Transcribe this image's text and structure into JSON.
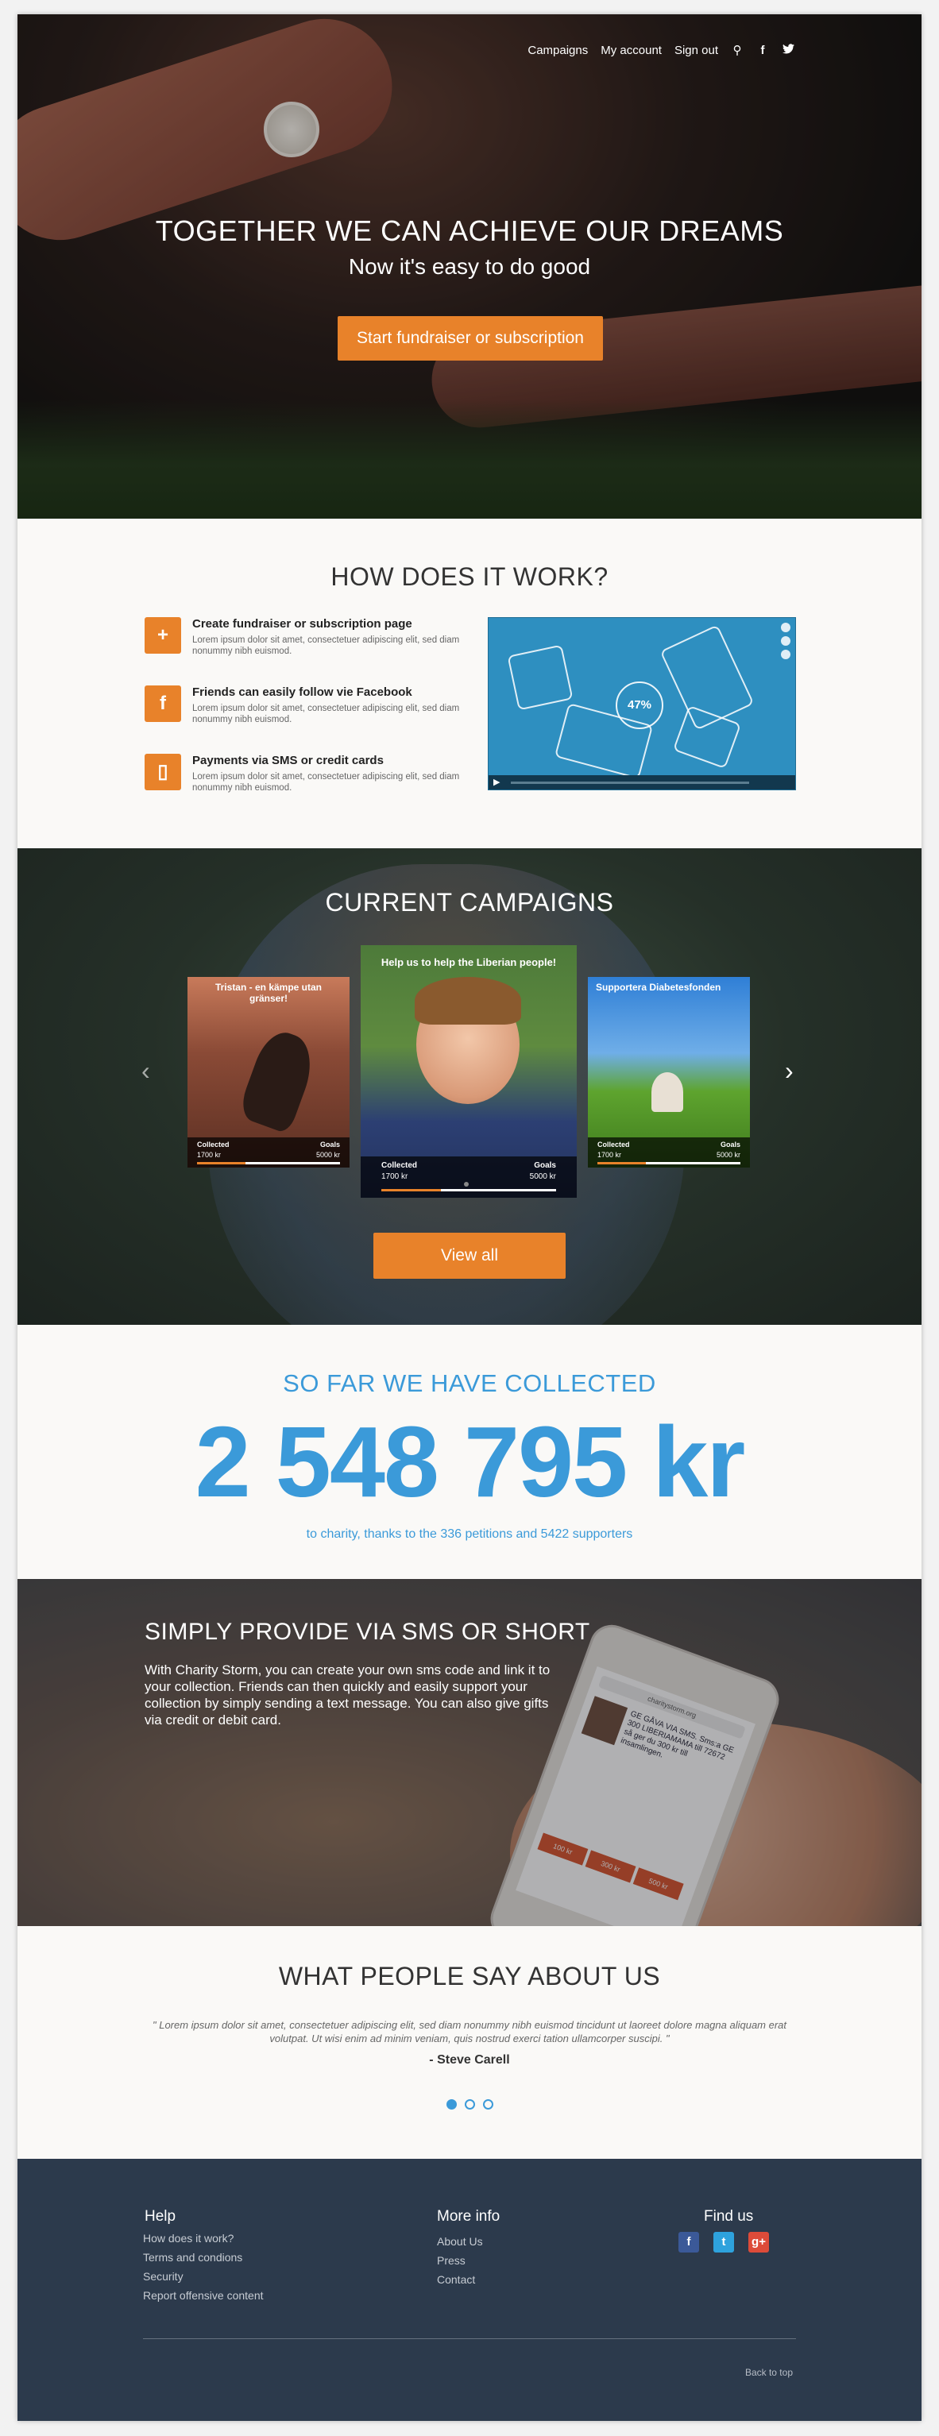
{
  "nav": {
    "campaigns": "Campaigns",
    "my_account": "My account",
    "sign_out": "Sign out",
    "search_icon": "⚲",
    "facebook_icon": "f",
    "twitter_icon": "🐦"
  },
  "hero": {
    "headline": "TOGETHER WE CAN ACHIEVE OUR DREAMS",
    "subheadline": "Now it's easy to do good",
    "cta_label": "Start fundraiser or subscription"
  },
  "how": {
    "title": "HOW DOES IT WORK?",
    "steps": [
      {
        "icon": "+",
        "title": "Create fundraiser or subscription page",
        "text": "Lorem ipsum dolor sit amet, consectetuer adipiscing elit, sed diam nonummy nibh euismod."
      },
      {
        "icon": "f",
        "title": "Friends can easily follow vie Facebook",
        "text": "Lorem ipsum dolor sit amet, consectetuer adipiscing elit, sed diam nonummy nibh euismod."
      },
      {
        "icon": "▯",
        "title": "Payments via SMS or credit cards",
        "text": "Lorem ipsum dolor sit amet, consectetuer adipiscing elit, sed diam nonummy nibh euismod."
      }
    ],
    "video_badge": "47%",
    "play_icon": "▶"
  },
  "campaigns": {
    "title": "CURRENT CAMPAIGNS",
    "prev_icon": "‹",
    "next_icon": "›",
    "view_all_label": "View all",
    "cards": [
      {
        "title": "Tristan - en kämpe utan gränser!",
        "collected_label": "Collected",
        "collected": "1700 kr",
        "goal_label": "Goals",
        "goal": "5000 kr",
        "progress": 0.34
      },
      {
        "title": "Help us to help the Liberian people!",
        "collected_label": "Collected",
        "collected": "1700 kr",
        "goal_label": "Goals",
        "goal": "5000 kr",
        "progress": 0.34
      },
      {
        "title": "Supportera Diabetesfonden",
        "collected_label": "Collected",
        "collected": "1700 kr",
        "goal_label": "Goals",
        "goal": "5000 kr",
        "progress": 0.34
      }
    ]
  },
  "collected": {
    "title": "SO FAR WE HAVE COLLECTED",
    "amount": "2 548 795 kr",
    "note": "to charity, thanks to the 336 petitions and 5422 supporters"
  },
  "sms": {
    "title": "SIMPLY PROVIDE VIA SMS OR SHORT",
    "text": "With Charity Storm, you can create your own sms code and link it to your collection. Friends can then quickly and easily support your collection by simply sending a text message. You can also give gifts via credit or debit card.",
    "phone_url": "charitystorm.org",
    "phone_text": "GE GÅVA VIA SMS. Sms:a GE 300 LIBERIAMAMA till 72672 så ger du 300 kr till insamlingen.",
    "phone_buttons": [
      "100 kr",
      "300 kr",
      "500 kr"
    ]
  },
  "testimonials": {
    "title": "WHAT PEOPLE SAY ABOUT US",
    "quote": "\" Lorem ipsum dolor sit amet, consectetuer adipiscing elit, sed diam nonummy nibh euismod tincidunt ut laoreet dolore magna aliquam erat volutpat. Ut wisi enim ad minim veniam, quis nostrud exerci tation ullamcorper suscipi. \"",
    "author": "-  Steve Carell"
  },
  "footer": {
    "help_title": "Help",
    "help_links": [
      "How does it work?",
      "Terms and condions",
      "Security",
      "Report offensive content"
    ],
    "more_title": "More info",
    "more_links": [
      "About Us",
      "Press",
      "Contact"
    ],
    "find_title": "Find us",
    "facebook": "f",
    "twitter": "t",
    "gplus": "g+",
    "back_to_top": "Back to top"
  }
}
